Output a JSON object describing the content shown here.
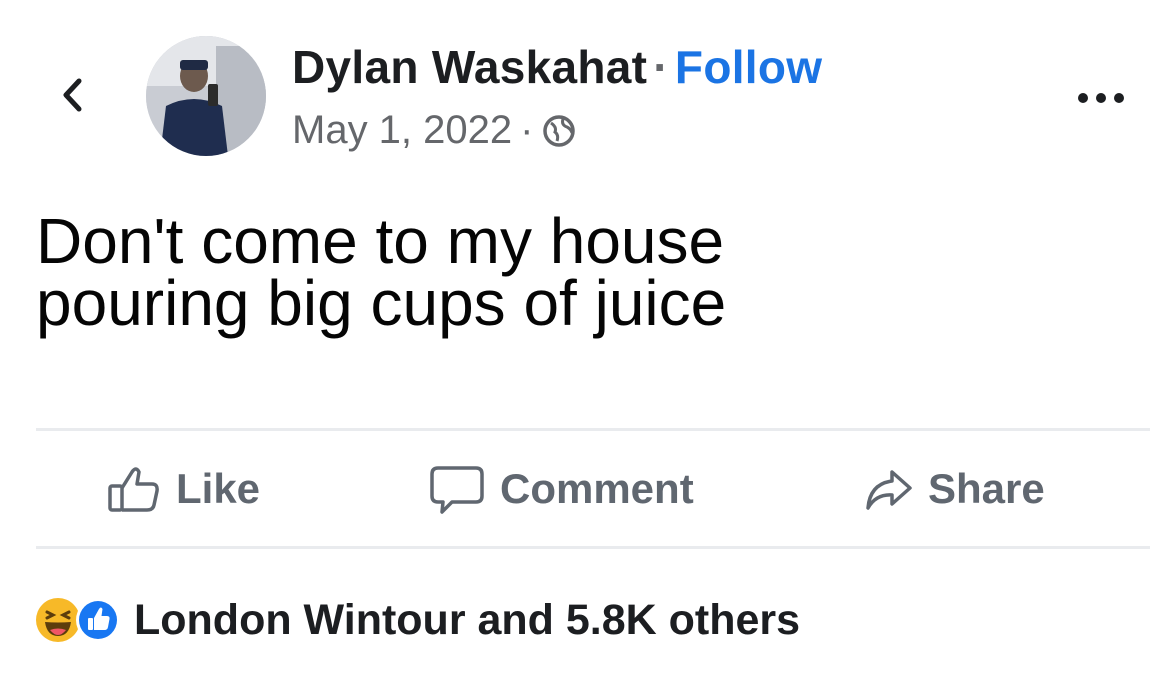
{
  "post": {
    "author_name": "Dylan Waskahat",
    "separator": "·",
    "follow_label": "Follow",
    "date": "May 1, 2022",
    "date_separator": "·",
    "audience_icon": "globe-icon",
    "body": "Don't come to my house\npouring big cups of juice"
  },
  "actions": {
    "like_label": "Like",
    "comment_label": "Comment",
    "share_label": "Share"
  },
  "reactions": {
    "icons": [
      "haha-reaction-icon",
      "like-reaction-icon"
    ],
    "summary": "London Wintour and 5.8K others"
  },
  "colors": {
    "link_blue": "#1b74e4",
    "text_dark": "#1c1e21",
    "text_muted": "#65676b",
    "haha_yellow": "#f7b928",
    "like_blue": "#1877f2"
  }
}
